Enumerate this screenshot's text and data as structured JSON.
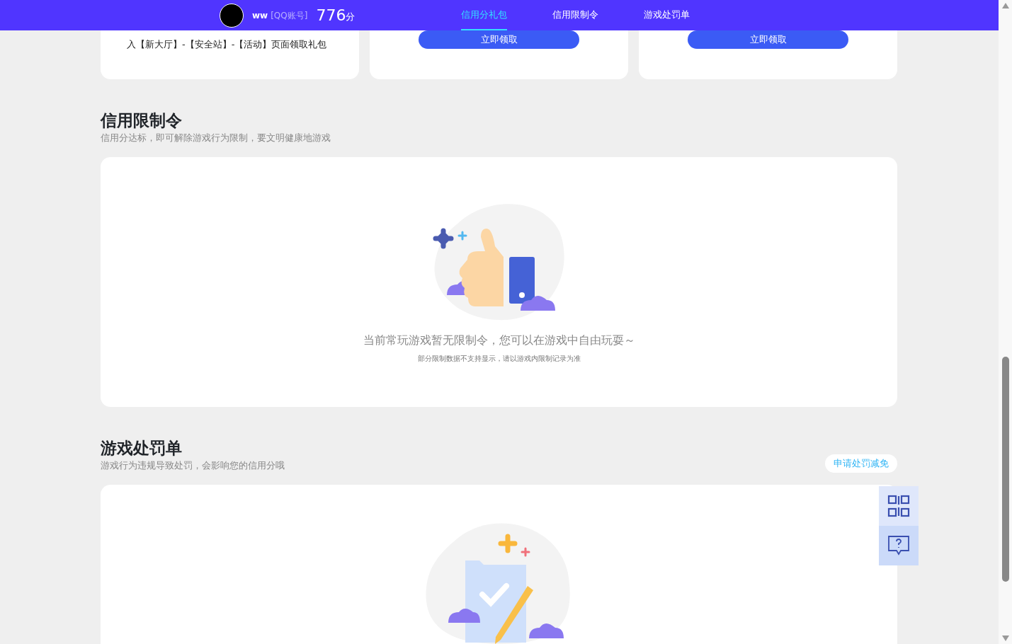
{
  "header": {
    "name": "ww",
    "account_type": "[QQ账号]",
    "score": "776",
    "score_unit": "分",
    "nav": [
      {
        "label": "信用分礼包",
        "selected": true
      },
      {
        "label": "信用限制令",
        "selected": false
      },
      {
        "label": "游戏处罚单",
        "selected": false
      }
    ]
  },
  "gift_cards": [
    {
      "kind": "text",
      "text": "入【新大厅】-【安全站】-【活动】页面领取礼包"
    },
    {
      "kind": "button",
      "button": "立即领取"
    },
    {
      "kind": "button",
      "button": "立即领取"
    }
  ],
  "restriction": {
    "title": "信用限制令",
    "subtitle": "信用分达标，即可解除游戏行为限制，要文明健康地游戏",
    "empty_message": "当前常玩游戏暂无限制令，您可以在游戏中自由玩耍～",
    "note": "部分限制数据不支持显示，请以游戏内限制记录为准"
  },
  "punishment": {
    "title": "游戏处罚单",
    "subtitle": "游戏行为违规导致处罚，会影响您的信用分哦",
    "action": "申请处罚减免"
  }
}
